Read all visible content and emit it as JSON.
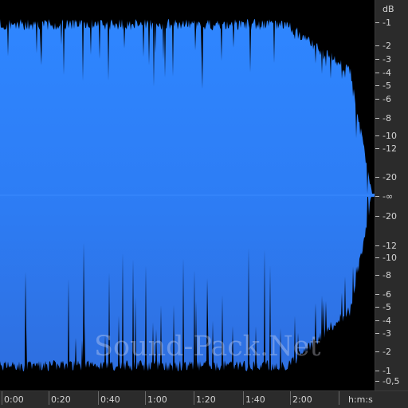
{
  "colors": {
    "background": "#000000",
    "waveform_top": "#2f86ff",
    "waveform_bottom": "#2e6fe0",
    "ruler_bg": "#2b2b2b",
    "ruler_text": "#d4d4d4"
  },
  "db_scale": {
    "unit": "dB",
    "labels": [
      "-1",
      "-2",
      "-3",
      "-4",
      "-5",
      "-6",
      "-8",
      "-10",
      "-12",
      "-20",
      "-∞",
      "-20",
      "-12",
      "-10",
      "-8",
      "-6",
      "-5",
      "-4",
      "-3",
      "-2",
      "-1",
      "-0,5"
    ]
  },
  "time_ruler": {
    "unit": "h:m:s",
    "labels": [
      "0:00",
      "0:20",
      "0:40",
      "1:00",
      "1:20",
      "1:40",
      "2:00"
    ]
  },
  "watermark": "Sound-Pack.Net"
}
